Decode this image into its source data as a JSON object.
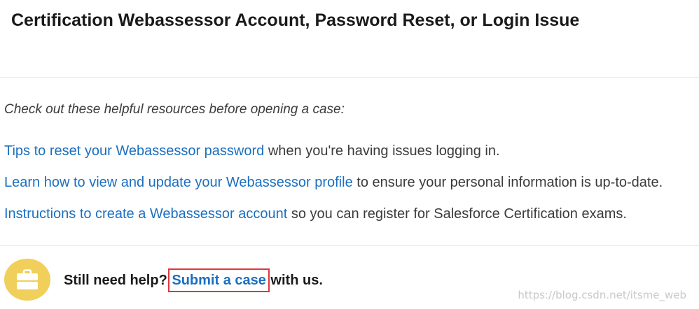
{
  "header": {
    "title": "Certification Webassessor Account, Password Reset, or Login Issue"
  },
  "content": {
    "intro": "Check out these helpful resources before opening a case:",
    "resources": [
      {
        "link_text": "Tips to reset your Webassessor password",
        "suffix": " when you're having issues logging in."
      },
      {
        "link_text": "Learn how to view and update your Webassessor profile",
        "suffix": " to ensure your personal information is up-to-date."
      },
      {
        "link_text": "Instructions to create a Webassessor account",
        "suffix": " so you can register for Salesforce Certification exams."
      }
    ]
  },
  "help": {
    "icon": "briefcase-icon",
    "prefix": "Still need help? ",
    "link_text": "Submit a case",
    "suffix": " with us."
  },
  "watermark": {
    "text": "https://blog.csdn.net/itsme_web"
  },
  "colors": {
    "link": "#1b6fc0",
    "icon_bg": "#f0cf5b",
    "highlight_border": "#e0353b"
  }
}
